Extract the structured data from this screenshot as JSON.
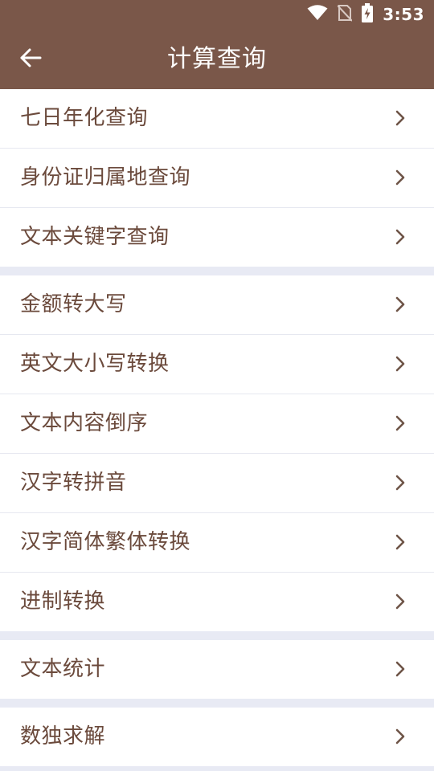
{
  "status_bar": {
    "time": "3:53",
    "icons": [
      "wifi-icon",
      "no-sim-icon",
      "battery-charging-icon"
    ]
  },
  "header": {
    "title": "计算查询",
    "back_icon": "arrow-left-icon"
  },
  "sections": [
    {
      "items": [
        {
          "label": "七日年化查询"
        },
        {
          "label": "身份证归属地查询"
        },
        {
          "label": "文本关键字查询"
        }
      ]
    },
    {
      "items": [
        {
          "label": "金额转大写"
        },
        {
          "label": "英文大小写转换"
        },
        {
          "label": "文本内容倒序"
        },
        {
          "label": "汉字转拼音"
        },
        {
          "label": "汉字简体繁体转换"
        },
        {
          "label": "进制转换"
        }
      ]
    },
    {
      "items": [
        {
          "label": "文本统计"
        }
      ]
    },
    {
      "items": [
        {
          "label": "数独求解"
        }
      ]
    }
  ],
  "colors": {
    "primary": "#7a5749",
    "item_text": "#6b4a3c",
    "chevron": "#6e5447",
    "divider_band": "#e8eaf4"
  }
}
